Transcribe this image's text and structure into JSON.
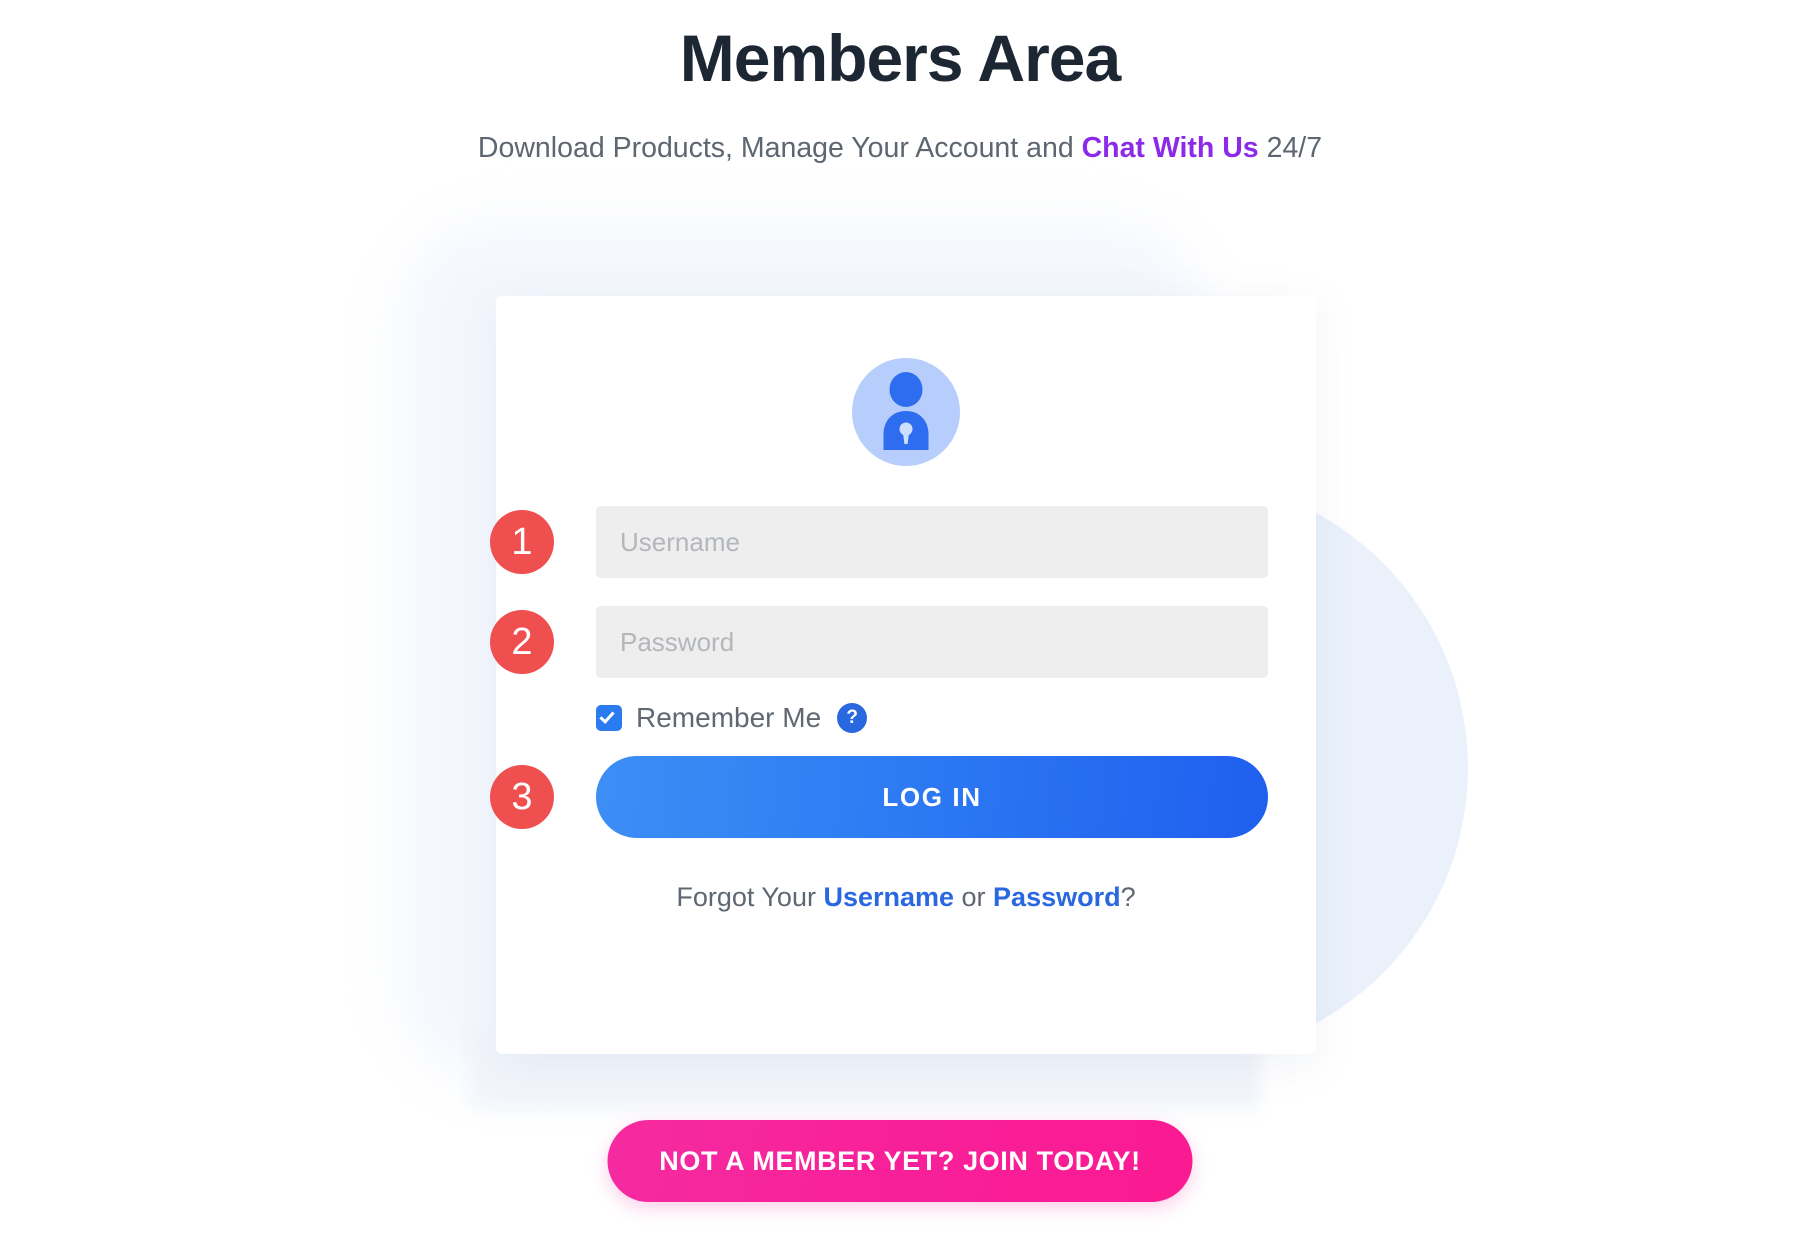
{
  "header": {
    "title": "Members Area",
    "subtitle_before": "Download Products, Manage Your Account and ",
    "subtitle_link": "Chat With Us",
    "subtitle_after": " 24/7"
  },
  "card": {
    "avatar_icon_name": "user-lock-icon",
    "fields": [
      {
        "step": "1",
        "name": "username",
        "placeholder": "Username",
        "value": ""
      },
      {
        "step": "2",
        "name": "password",
        "placeholder": "Password",
        "value": ""
      }
    ],
    "remember": {
      "label": "Remember Me",
      "checked": true,
      "help_glyph": "?"
    },
    "login": {
      "step": "3",
      "label": "LOG IN"
    },
    "forgot": {
      "prefix": "Forgot Your ",
      "username_link": "Username",
      "separator": " or ",
      "password_link": "Password",
      "suffix": "?"
    }
  },
  "join_button": {
    "label": "NOT A MEMBER YET? JOIN TODAY!"
  },
  "colors": {
    "page_background": "#ffffff",
    "title": "#1d2733",
    "subtitle": "#5d6671",
    "subtitle_accent": "#8b2ae8",
    "step_badge": "#ef4f4f",
    "input_background": "#eeeeee",
    "placeholder": "#b3b6ba",
    "login_gradient_start": "#3d8ef5",
    "login_gradient_end": "#1f5fef",
    "link_blue": "#2a68e0",
    "join_gradient_start": "#f52ba0",
    "join_gradient_end": "#fa1a92",
    "avatar_circle": "#b7cdfb",
    "avatar_figure": "#2f6df0",
    "blob": "#eaf1fb"
  }
}
